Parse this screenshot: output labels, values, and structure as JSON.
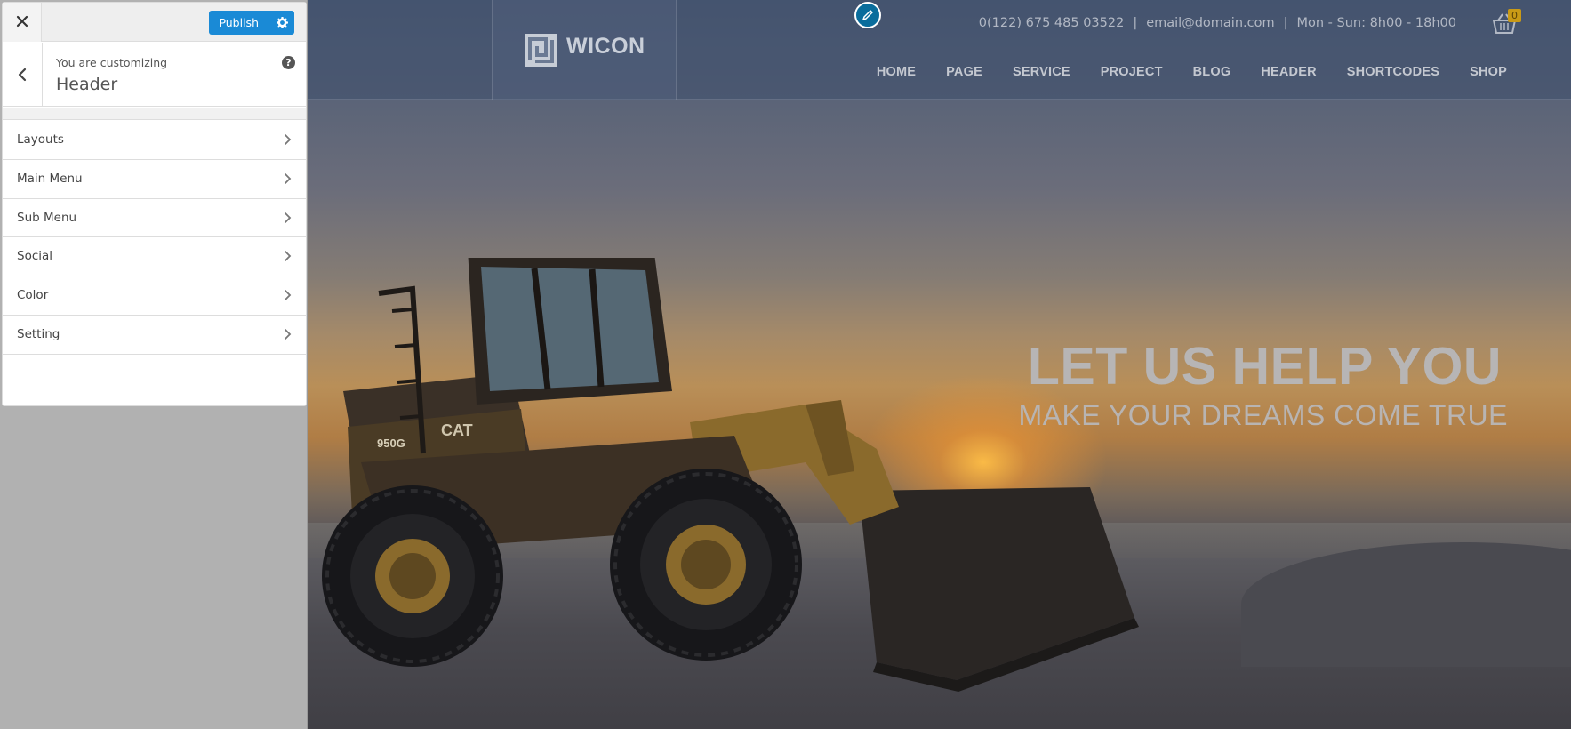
{
  "customizer": {
    "close_icon": "close-icon",
    "publish_label": "Publish",
    "publish_settings_icon": "gear-icon",
    "customizing_label": "You are customizing",
    "section_title": "Header",
    "back_icon": "chevron-left-icon",
    "help_icon_text": "?",
    "menu_items": [
      {
        "label": "Layouts"
      },
      {
        "label": "Main Menu"
      },
      {
        "label": "Sub Menu"
      },
      {
        "label": "Social"
      },
      {
        "label": "Color"
      },
      {
        "label": "Setting"
      }
    ]
  },
  "site": {
    "logo_text": "WICON",
    "phone": "0(122) 675 485 03522",
    "email": "email@domain.com",
    "hours": "Mon - Sun: 8h00 - 18h00",
    "separator": "|",
    "cart_count": "0",
    "nav": [
      "HOME",
      "PAGE",
      "SERVICE",
      "PROJECT",
      "BLOG",
      "HEADER",
      "SHORTCODES",
      "SHOP"
    ],
    "hero_title": "LET US HELP YOU",
    "hero_subtitle": "MAKE YOUR DREAMS COME TRUE",
    "loader_badge": "950G",
    "loader_brand": "CAT"
  },
  "colors": {
    "publish_blue": "#1a8ad6",
    "edit_pencil_blue": "#0a6d9c",
    "cart_badge": "#c99a16"
  }
}
